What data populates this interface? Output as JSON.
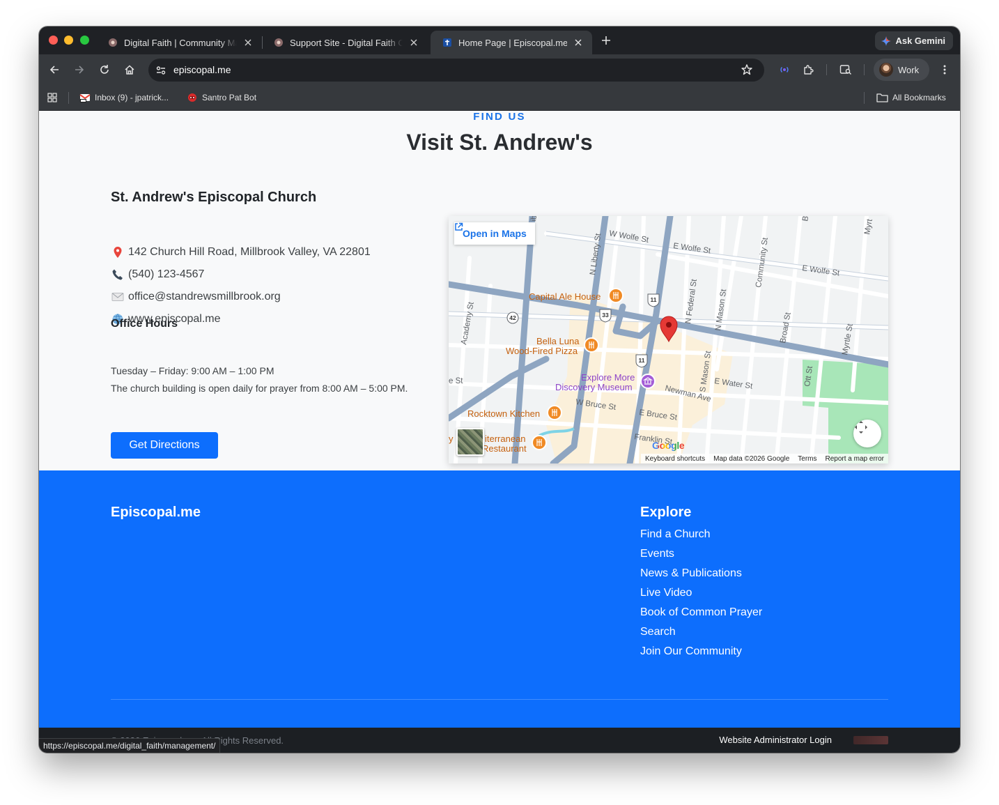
{
  "browser": {
    "tabs": [
      {
        "title": "Digital Faith | Community Man",
        "icon": "digital-faith-logo-icon",
        "active": false
      },
      {
        "title": "Support Site - Digital Faith Co",
        "icon": "digital-faith-logo-icon",
        "active": false
      },
      {
        "title": "Home Page | Episcopal.me",
        "icon": "cross-icon",
        "active": true
      }
    ],
    "ask_gemini": "Ask Gemini",
    "url": "episcopal.me",
    "profile_name": "Work",
    "bookmarks": [
      {
        "label": "Inbox (9) - jpatrick...",
        "icon": "gmail-icon"
      },
      {
        "label": "Santro Pat Bot",
        "icon": "bot-icon"
      }
    ],
    "all_bookmarks": "All Bookmarks",
    "status_url": "https://episcopal.me/digital_faith/management/"
  },
  "find_us": {
    "eyebrow": "FIND US",
    "title": "Visit St. Andrew's",
    "church_name": "St. Andrew's Episcopal Church",
    "address": "142 Church Hill Road, Millbrook Valley, VA 22801",
    "phone": "(540) 123-4567",
    "email": "office@standrewsmillbrook.org",
    "website": "www.episcopal.me",
    "office_hours_title": "Office Hours",
    "hours_line_1": "Tuesday – Friday: 9:00 AM – 1:00 PM",
    "hours_line_2": "The church building is open daily for prayer from 8:00 AM – 5:00 PM.",
    "directions_button": "Get Directions"
  },
  "map": {
    "open_in_maps": "Open in Maps",
    "google": "Google",
    "footer": {
      "shortcuts": "Keyboard shortcuts",
      "map_data": "Map data ©2026 Google",
      "terms": "Terms",
      "report": "Report a map error"
    },
    "streets": {
      "w_wolfe": "W Wolfe St",
      "e_wolfe_1": "E Wolfe St",
      "e_wolfe_2": "E Wolfe St",
      "n_liberty": "N Liberty St",
      "academy": "Academy St",
      "n_federal": "N Federal St",
      "n_mason": "N Mason St",
      "community": "Community St",
      "broad": "Broad St",
      "myrtle_1": "Myrtle St",
      "myrtle_2": "Myrt",
      "b_st": "B",
      "s_mason": "S Mason St",
      "e_water": "E Water St",
      "newman": "Newman Ave",
      "w_bruce": "W Bruce St",
      "e_bruce": "E Bruce St",
      "franklin": "Franklin St",
      "ott": "Ott St",
      "e_st": "e St",
      "lib": "ib"
    },
    "route_shields": {
      "r42": "42",
      "r33": "33",
      "r11a": "11",
      "r11b": "11"
    },
    "places": {
      "capital_ale": "Capital Ale House",
      "bella_luna_1": "Bella Luna",
      "bella_luna_2": "Wood-Fired Pizza",
      "explore_more_1": "Explore More",
      "explore_more_2": "Discovery Museum",
      "rocktown": "Rocktown Kitchen",
      "mediterranean_1": "iterranean",
      "mediterranean_2": "Restaurant",
      "med_prefix": "y"
    },
    "colors": {
      "land": "#f1f3f4",
      "road": "#ffffff",
      "major_road": "#8ea5c1",
      "downtown": "#fbf0da",
      "park": "#a8e6b8",
      "restaurant": "#f08a24",
      "museum": "#a35cd6",
      "pin": "#e53935"
    }
  },
  "footer": {
    "brand": "Episcopal.me",
    "explore_title": "Explore",
    "links": [
      "Find a Church",
      "Events",
      "News & Publications",
      "Live Video",
      "Book of Common Prayer",
      "Search",
      "Join Our Community"
    ],
    "copyright": "© 2026 Episcopal.me. All Rights Reserved.",
    "admin_login": "Website Administrator Login",
    "accent": "#0d6efd"
  }
}
